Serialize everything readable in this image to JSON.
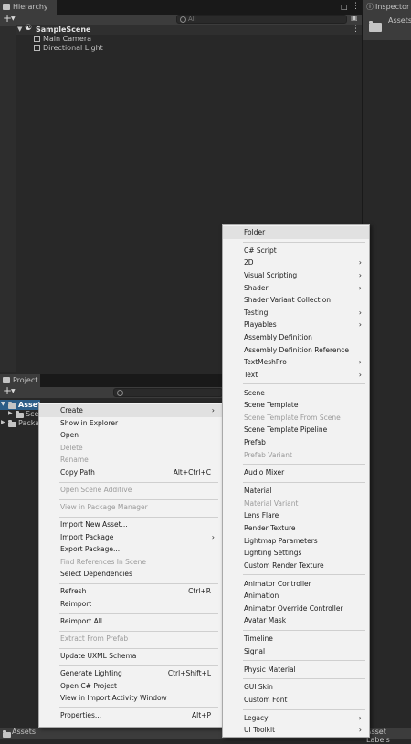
{
  "hierarchy": {
    "tab": "Hierarchy",
    "search_placeholder": "All",
    "scene": "SampleScene",
    "objects": [
      "Main Camera",
      "Directional Light"
    ]
  },
  "inspector": {
    "tab": "Inspector",
    "assets_label": "Assets"
  },
  "project": {
    "tab": "Project",
    "tree": [
      "Assets",
      "Scenes",
      "Packages"
    ]
  },
  "bottom": {
    "left": "Assets",
    "right": "Asset Labels"
  },
  "context_menu": {
    "items": [
      {
        "label": "Create",
        "arrow": true,
        "highlight": true
      },
      {
        "label": "Show in Explorer"
      },
      {
        "label": "Open"
      },
      {
        "label": "Delete",
        "disabled": true
      },
      {
        "label": "Rename",
        "disabled": true
      },
      {
        "label": "Copy Path",
        "shortcut": "Alt+Ctrl+C"
      },
      {
        "sep": true
      },
      {
        "label": "Open Scene Additive",
        "disabled": true
      },
      {
        "sep": true
      },
      {
        "label": "View in Package Manager",
        "disabled": true
      },
      {
        "sep": true
      },
      {
        "label": "Import New Asset..."
      },
      {
        "label": "Import Package",
        "arrow": true
      },
      {
        "label": "Export Package..."
      },
      {
        "label": "Find References In Scene",
        "disabled": true
      },
      {
        "label": "Select Dependencies"
      },
      {
        "sep": true
      },
      {
        "label": "Refresh",
        "shortcut": "Ctrl+R"
      },
      {
        "label": "Reimport"
      },
      {
        "sep": true
      },
      {
        "label": "Reimport All"
      },
      {
        "sep": true
      },
      {
        "label": "Extract From Prefab",
        "disabled": true
      },
      {
        "sep": true
      },
      {
        "label": "Update UXML Schema"
      },
      {
        "sep": true
      },
      {
        "label": "Generate Lighting",
        "shortcut": "Ctrl+Shift+L"
      },
      {
        "label": "Open C# Project"
      },
      {
        "label": "View in Import Activity Window"
      },
      {
        "sep": true
      },
      {
        "label": "Properties...",
        "shortcut": "Alt+P"
      }
    ]
  },
  "create_submenu": {
    "items": [
      {
        "label": "Folder",
        "highlight": true
      },
      {
        "sep": true
      },
      {
        "label": "C# Script"
      },
      {
        "label": "2D",
        "arrow": true
      },
      {
        "label": "Visual Scripting",
        "arrow": true
      },
      {
        "label": "Shader",
        "arrow": true
      },
      {
        "label": "Shader Variant Collection"
      },
      {
        "label": "Testing",
        "arrow": true
      },
      {
        "label": "Playables",
        "arrow": true
      },
      {
        "label": "Assembly Definition"
      },
      {
        "label": "Assembly Definition Reference"
      },
      {
        "label": "TextMeshPro",
        "arrow": true
      },
      {
        "label": "Text",
        "arrow": true
      },
      {
        "sep": true
      },
      {
        "label": "Scene"
      },
      {
        "label": "Scene Template"
      },
      {
        "label": "Scene Template From Scene",
        "disabled": true
      },
      {
        "label": "Scene Template Pipeline"
      },
      {
        "label": "Prefab"
      },
      {
        "label": "Prefab Variant",
        "disabled": true
      },
      {
        "sep": true
      },
      {
        "label": "Audio Mixer"
      },
      {
        "sep": true
      },
      {
        "label": "Material"
      },
      {
        "label": "Material Variant",
        "disabled": true
      },
      {
        "label": "Lens Flare"
      },
      {
        "label": "Render Texture"
      },
      {
        "label": "Lightmap Parameters"
      },
      {
        "label": "Lighting Settings"
      },
      {
        "label": "Custom Render Texture"
      },
      {
        "sep": true
      },
      {
        "label": "Animator Controller"
      },
      {
        "label": "Animation"
      },
      {
        "label": "Animator Override Controller"
      },
      {
        "label": "Avatar Mask"
      },
      {
        "sep": true
      },
      {
        "label": "Timeline"
      },
      {
        "label": "Signal"
      },
      {
        "sep": true
      },
      {
        "label": "Physic Material"
      },
      {
        "sep": true
      },
      {
        "label": "GUI Skin"
      },
      {
        "label": "Custom Font"
      },
      {
        "sep": true
      },
      {
        "label": "Legacy",
        "arrow": true
      },
      {
        "label": "UI Toolkit",
        "arrow": true
      }
    ]
  }
}
